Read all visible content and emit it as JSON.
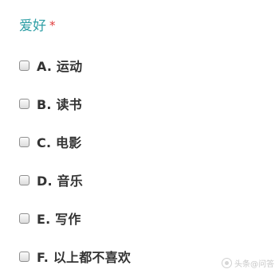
{
  "question": {
    "title": "爱好",
    "required_mark": "*",
    "title_color": "#2f9fa6",
    "required_color": "#e03c3c"
  },
  "options": [
    {
      "label": "A. 运动",
      "checked": false
    },
    {
      "label": "B. 读书",
      "checked": false
    },
    {
      "label": "C. 电影",
      "checked": false
    },
    {
      "label": "D. 音乐",
      "checked": false
    },
    {
      "label": "E. 写作",
      "checked": false
    },
    {
      "label": "F. 以上都不喜欢",
      "checked": false
    }
  ],
  "watermark": {
    "text": "头条@问答",
    "icon": "brand-logo-icon"
  }
}
